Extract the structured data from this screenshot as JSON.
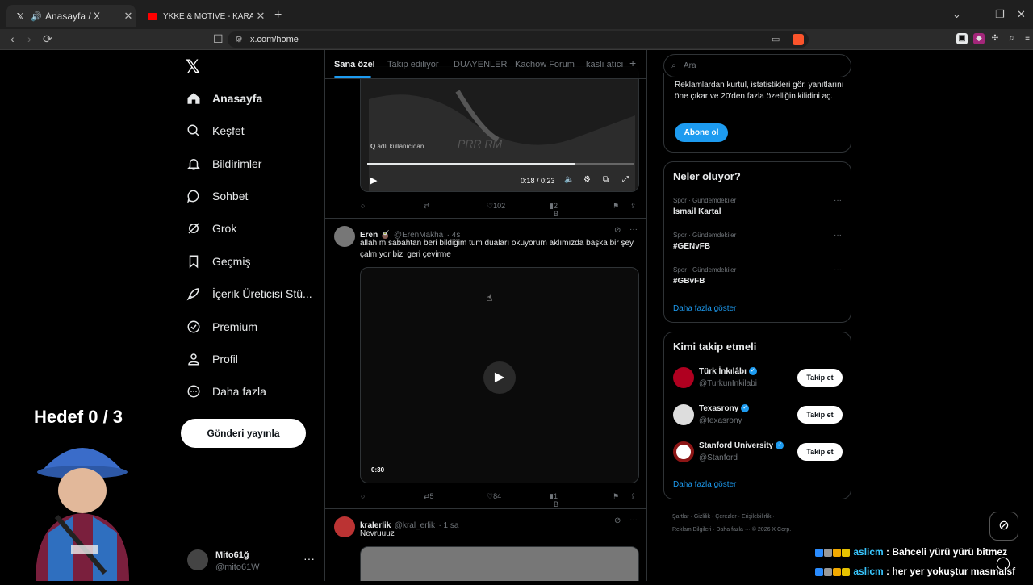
{
  "browser": {
    "tabs": [
      {
        "title": "Anasayfa / X",
        "close": "✕"
      },
      {
        "title": "YKKE & MOTIVE - KARANLIK (Official",
        "close": "✕"
      }
    ],
    "new_tab": "+",
    "url": "x.com/home"
  },
  "nav": {
    "logo": "𝕏",
    "items": [
      {
        "label": "Anasayfa"
      },
      {
        "label": "Keşfet"
      },
      {
        "label": "Bildirimler"
      },
      {
        "label": "Sohbet"
      },
      {
        "label": "Grok"
      },
      {
        "label": "Geçmiş"
      },
      {
        "label": "İçerik Üreticisi Stü..."
      },
      {
        "label": "Premium"
      },
      {
        "label": "Profil"
      },
      {
        "label": "Daha fazla"
      }
    ],
    "post_button": "Gönderi yayınla",
    "user": {
      "name": "Mito61ğ",
      "handle": "@mito61W",
      "more": "···"
    }
  },
  "overlay": {
    "goal": "Hedef 0 / 3"
  },
  "feed": {
    "tabs": [
      "Sana özel",
      "Takip ediliyor",
      "DUAYENLER",
      "Kachow Forum",
      "kaslı atıcı"
    ],
    "add_tab": "+",
    "video1": {
      "watermark": "adlı kullanıcıdan",
      "watermark_q": "Q",
      "time": "0:18 / 0:23",
      "progress": 0.78,
      "likes": "102",
      "views": "2 B"
    },
    "tweet2": {
      "name": "Eren 🧉",
      "handle": "@ErenMakha",
      "time": "· 4s",
      "text": "allahım sabahtan beri bildiğim tüm duaları okuyorum aklımızda başka bir şey çalmıyor bizi geri çevirme",
      "duration": "0:30",
      "retweets": "5",
      "likes": "84",
      "views": "1 B"
    },
    "tweet3": {
      "name": "kralerlik",
      "handle": "@kral_erlik",
      "time": "· 1 sa",
      "text": "Nevruuuz"
    }
  },
  "right": {
    "search_placeholder": "Ara",
    "premium": {
      "text": "Reklamlardan kurtul, istatistikleri gör, yanıtlarını öne çıkar ve 20'den fazla özelliğin kilidini aç.",
      "button": "Abone ol"
    },
    "trends": {
      "title": "Neler oluyor?",
      "items": [
        {
          "meta": "Spor · Gündemdekiler",
          "name": "İsmail Kartal"
        },
        {
          "meta": "Spor · Gündemdekiler",
          "name": "#GENvFB"
        },
        {
          "meta": "Spor · Gündemdekiler",
          "name": "#GBvFB"
        }
      ],
      "show_more": "Daha fazla göster"
    },
    "who_to_follow": {
      "title": "Kimi takip etmeli",
      "items": [
        {
          "name": "Türk İnkılâbı",
          "handle": "@TurkunInkilabi",
          "button": "Takip et"
        },
        {
          "name": "Texasrony",
          "handle": "@texasrony",
          "button": "Takip et"
        },
        {
          "name": "Stanford University",
          "handle": "@Stanford",
          "button": "Takip et"
        }
      ],
      "show_more": "Daha fazla göster"
    },
    "footer": {
      "line1": "Şartlar · Gizlilik · Çerezler · Erişilebilirlik ·",
      "line2": "Reklam Bilgileri · Daha fazla ··· © 2026 X Corp."
    }
  },
  "chat": [
    {
      "user": "aslicm",
      "message": ": Bahceli yürü yürü bitmez"
    },
    {
      "user": "aslicm",
      "message": ": her yer yokuştur masmalsf"
    }
  ],
  "colors": {
    "accent": "#1d9bf0",
    "chat_user": "#39c7ff",
    "youtube": "#ff0000"
  }
}
